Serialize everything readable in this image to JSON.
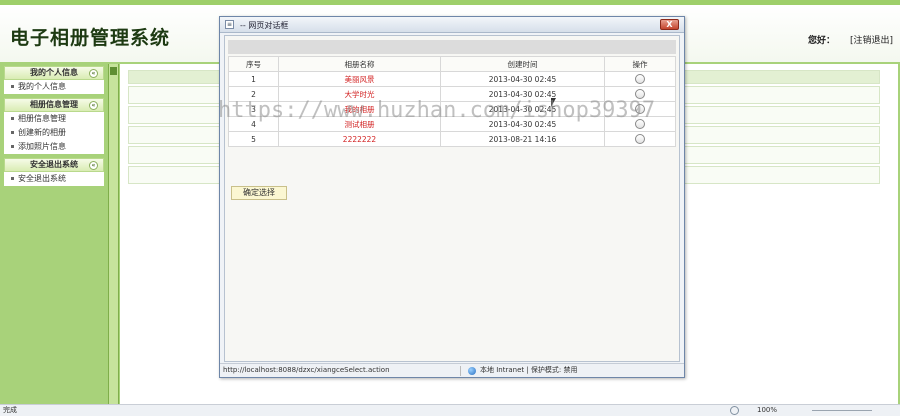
{
  "app": {
    "title": "电子相册管理系统"
  },
  "header": {
    "greeting": "您好：",
    "logout_label": "[注销退出]"
  },
  "sidebar": {
    "groups": [
      {
        "title": "我的个人信息",
        "items": [
          "我的个人信息"
        ]
      },
      {
        "title": "相册信息管理",
        "items": [
          "相册信息管理",
          "创建新的相册",
          "添加照片信息"
        ]
      },
      {
        "title": "安全退出系统",
        "items": [
          "安全退出系统"
        ]
      }
    ],
    "toggle_symbol": "«"
  },
  "dialog": {
    "title": "-- 网页对话框",
    "close_label": "X",
    "icon_symbol": "≡",
    "table": {
      "headers": [
        "序号",
        "相册名称",
        "创建时间",
        "操作"
      ],
      "rows": [
        {
          "num": "1",
          "name": "美丽风景",
          "time": "2013-04-30 02:45"
        },
        {
          "num": "2",
          "name": "大学时光",
          "time": "2013-04-30 02:45"
        },
        {
          "num": "3",
          "name": "我的相册",
          "time": "2013-04-30 02:45"
        },
        {
          "num": "4",
          "name": "测试相册",
          "time": "2013-04-30 02:45"
        },
        {
          "num": "5",
          "name": "2222222",
          "time": "2013-08-21 14:16"
        }
      ]
    },
    "confirm_label": "确定选择",
    "status_url": "http://localhost:8088/dzxc/xiangceSelect.action",
    "status_zone": "本地 Intranet | 保护模式: 禁用"
  },
  "statusbar": {
    "left_text": "完成",
    "zoom": "100%"
  },
  "watermark": "https://www.huzhan.com/ishop39397",
  "colors": {
    "accent_green": "#a8d27a",
    "album_name": "#d22020",
    "close_red": "#c4452d"
  }
}
